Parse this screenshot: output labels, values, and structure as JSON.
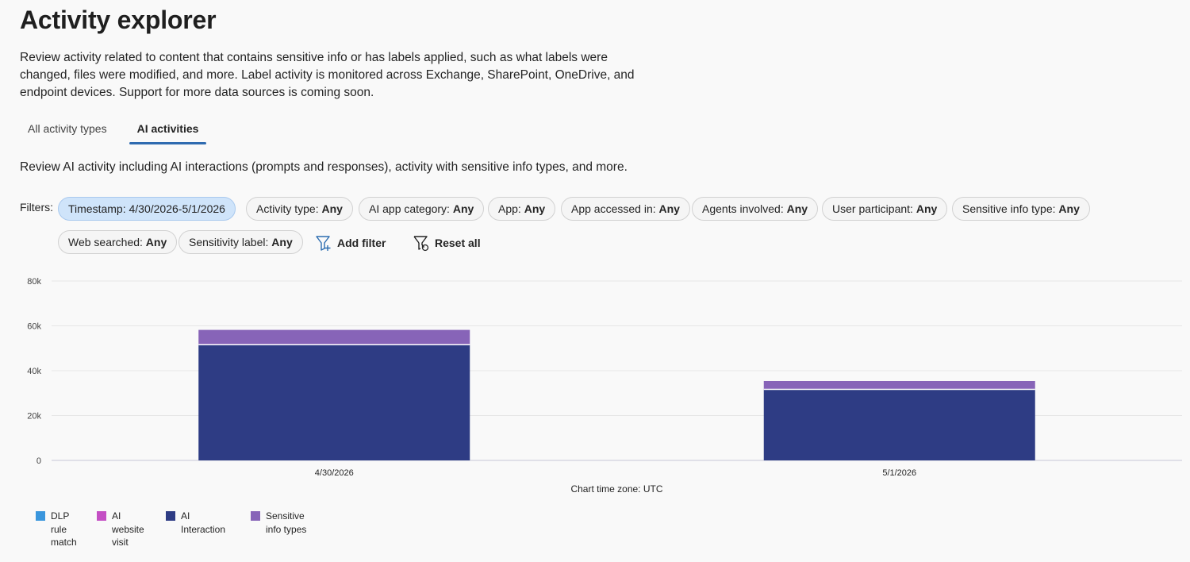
{
  "page": {
    "title": "Activity explorer",
    "description": "Review activity related to content that contains sensitive info or has labels applied, such as what labels were changed, files were modified, and more. Label activity is monitored across Exchange, SharePoint, OneDrive, and endpoint devices. Support for more data sources is coming soon."
  },
  "tabs": [
    {
      "label": "All activity types",
      "active": false
    },
    {
      "label": "AI activities",
      "active": true
    }
  ],
  "ai_description": "Review AI activity including AI interactions (prompts and responses), activity with sensitive info types, and more.",
  "filters": {
    "label": "Filters:",
    "chips": [
      {
        "key": "Timestamp:",
        "value": "4/30/2026-5/1/2026",
        "selected": true
      },
      {
        "key": "Activity type:",
        "value": "Any"
      },
      {
        "key": "AI app category:",
        "value": "Any"
      },
      {
        "key": "App:",
        "value": "Any"
      },
      {
        "key": "App accessed in:",
        "value": "Any"
      },
      {
        "key": "Agents involved:",
        "value": "Any"
      },
      {
        "key": "User participant:",
        "value": "Any"
      },
      {
        "key": "Sensitive info type:",
        "value": "Any"
      },
      {
        "key": "Web searched:",
        "value": "Any"
      },
      {
        "key": "Sensitivity label:",
        "value": "Any"
      }
    ],
    "add_filter_label": "Add filter",
    "reset_all_label": "Reset all",
    "add_filter_icon": "filter-add-icon",
    "reset_icon": "filter-reset-icon"
  },
  "chart_data": {
    "type": "bar",
    "stacked": true,
    "categories": [
      "4/30/2026",
      "5/1/2026"
    ],
    "series": [
      {
        "name": "DLP rule match",
        "color": "#3a96dd",
        "values": [
          0,
          0
        ]
      },
      {
        "name": "AI website visit",
        "color": "#c44fc4",
        "values": [
          0,
          0
        ]
      },
      {
        "name": "AI Interaction",
        "color": "#2e3c84",
        "values": [
          51600,
          31700
        ]
      },
      {
        "name": "Sensitive info types",
        "color": "#8764b8",
        "values": [
          6600,
          3700
        ]
      }
    ],
    "ylim": [
      0,
      80000
    ],
    "yticks": [
      0,
      20000,
      40000,
      60000,
      80000
    ],
    "ytick_labels": [
      "0",
      "20k",
      "40k",
      "60k",
      "80k"
    ],
    "xlabel": "Chart time zone: UTC",
    "grid": true,
    "legend_position": "bottom-left"
  }
}
